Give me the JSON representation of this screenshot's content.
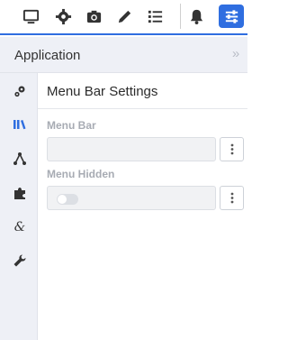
{
  "toolbar": {
    "icons": [
      {
        "name": "monitor-icon"
      },
      {
        "name": "gear-icon"
      },
      {
        "name": "camera-icon"
      },
      {
        "name": "pencil-icon"
      },
      {
        "name": "list-icon"
      },
      {
        "name": "bell-icon"
      },
      {
        "name": "sliders-icon",
        "active": true
      }
    ],
    "accent_color": "#2f6ee0"
  },
  "panel": {
    "title": "Application",
    "collapse_glyph": "»"
  },
  "rail": {
    "items": [
      {
        "name": "gears-icon"
      },
      {
        "name": "library-icon",
        "active": true
      },
      {
        "name": "share-nodes-icon"
      },
      {
        "name": "puzzle-icon"
      },
      {
        "name": "ampersand-icon"
      },
      {
        "name": "wrench-icon"
      }
    ]
  },
  "main": {
    "section_title": "Menu Bar Settings",
    "fields": [
      {
        "label": "Menu Bar",
        "value": ""
      },
      {
        "label": "Menu Hidden",
        "type": "toggle",
        "on": false
      }
    ]
  }
}
